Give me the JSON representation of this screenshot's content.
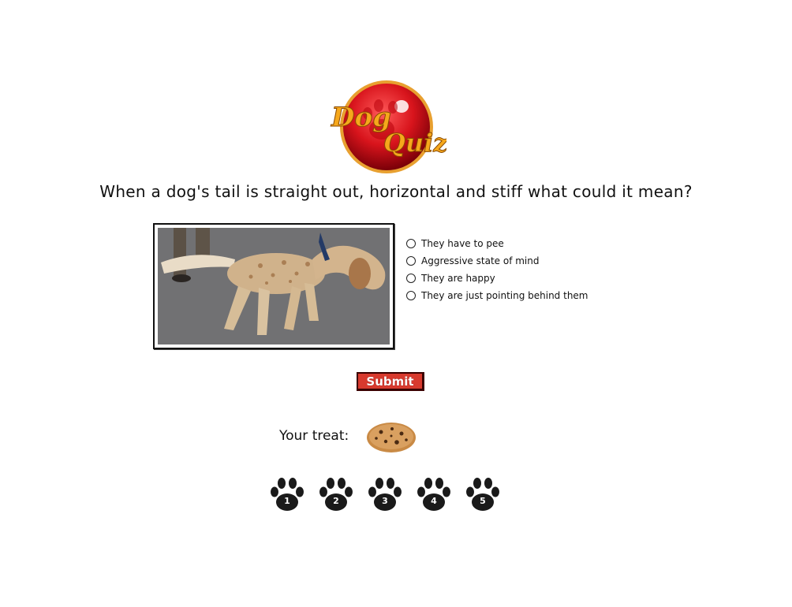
{
  "logo": {
    "line1": "Dog",
    "line2": "Quiz",
    "color": "#d8141c"
  },
  "question": "When a dog's tail is straight out, horizontal and stiff what could it mean?",
  "answers": [
    "They have to pee",
    "Aggressive state of mind",
    "They are happy",
    "They are just pointing behind them"
  ],
  "submit_label": "Submit",
  "treat_label": "Your treat:",
  "paws": [
    "1",
    "2",
    "3",
    "4",
    "5"
  ],
  "colors": {
    "submit_bg": "#d83a2e",
    "logo_text": "#f6a81c",
    "paw": "#1a1a1a"
  }
}
